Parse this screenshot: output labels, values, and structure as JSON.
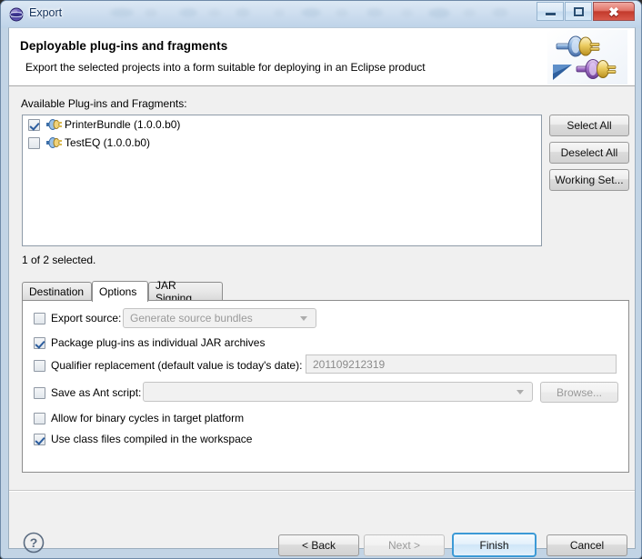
{
  "window": {
    "title": "Export",
    "title_icon": "eclipse-globe-icon",
    "controls": {
      "minimize": "minimize-button",
      "maximize": "maximize-button",
      "close_glyph": "✖"
    }
  },
  "banner": {
    "title": "Deployable plug-ins and fragments",
    "description": "Export the selected projects into a form suitable for deploying in an Eclipse product",
    "icon": "plugin-export-icon"
  },
  "plugins_section": {
    "label": "Available Plug-ins and Fragments:",
    "items": [
      {
        "name": "PrinterBundle (1.0.0.b0)",
        "checked": true
      },
      {
        "name": "TestEQ (1.0.0.b0)",
        "checked": false
      }
    ],
    "buttons": {
      "select_all": "Select All",
      "deselect_all": "Deselect All",
      "working_set": "Working Set..."
    },
    "selection_status": "1 of 2 selected."
  },
  "tabs": [
    {
      "label": "Destination",
      "active": false
    },
    {
      "label": "Options",
      "active": true
    },
    {
      "label": "JAR Signing",
      "active": false
    }
  ],
  "options": {
    "export_source": {
      "label": "Export source:",
      "checked": false,
      "combo_value": "Generate source bundles"
    },
    "package_jars": {
      "label": "Package plug-ins as individual JAR archives",
      "checked": true
    },
    "qualifier": {
      "label": "Qualifier replacement (default value is today's date):",
      "checked": false,
      "value": "201109212319"
    },
    "ant_script": {
      "label": "Save as Ant script:",
      "checked": false,
      "value": "",
      "browse_label": "Browse..."
    },
    "binary_cycles": {
      "label": "Allow for binary cycles in target platform",
      "checked": false
    },
    "use_class_files": {
      "label": "Use class files compiled in the workspace",
      "checked": true
    }
  },
  "footer": {
    "help": "?",
    "back": "< Back",
    "next": "Next >",
    "finish": "Finish",
    "cancel": "Cancel"
  },
  "colors": {
    "accent": "#3c9ad6",
    "title_text": "#13325c",
    "close_red": "#c33a2c"
  }
}
